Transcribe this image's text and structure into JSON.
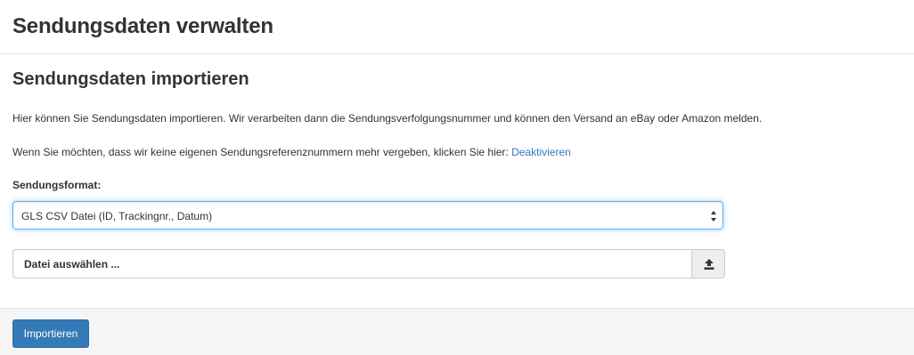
{
  "header": {
    "title": "Sendungsdaten verwalten"
  },
  "section": {
    "title": "Sendungsdaten importieren",
    "intro": "Hier können Sie Sendungsdaten importieren. Wir verarbeiten dann die Sendungsverfolgungsnummer und können den Versand an eBay oder Amazon melden.",
    "deactivate_text": "Wenn Sie möchten, dass wir keine eigenen Sendungsreferenznummern mehr vergeben, klicken Sie hier:",
    "deactivate_link": "Deaktivieren"
  },
  "form": {
    "format_label": "Sendungsformat:",
    "format_selected": "GLS CSV Datei (ID, Trackingnr., Datum)",
    "file_placeholder": "Datei auswählen ...",
    "upload_icon": "upload-icon"
  },
  "footer": {
    "import_label": "Importieren"
  },
  "colors": {
    "link": "#337ab7",
    "primary_button": "#337ab7",
    "focus_border": "#66afe9",
    "footer_bg": "#f5f5f5"
  }
}
